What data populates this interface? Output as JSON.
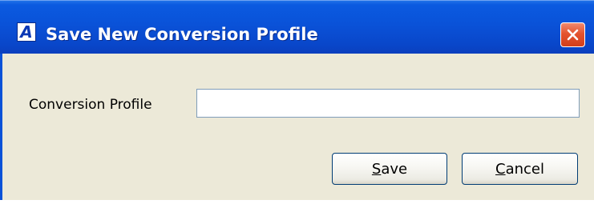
{
  "window": {
    "title": "Save New Conversion Profile",
    "app_icon_letter": "A",
    "close_icon": "close-x-icon"
  },
  "form": {
    "label": "Conversion Profile",
    "input_value": "",
    "input_placeholder": ""
  },
  "buttons": {
    "save": {
      "accel": "S",
      "rest": "ave"
    },
    "cancel": {
      "accel": "C",
      "rest": "ancel"
    }
  },
  "colors": {
    "titlebar": "#0a52d8",
    "dialog_background": "#ece9d8",
    "close_button": "#e4532e",
    "input_border": "#7f9db9",
    "button_border": "#003c74"
  }
}
